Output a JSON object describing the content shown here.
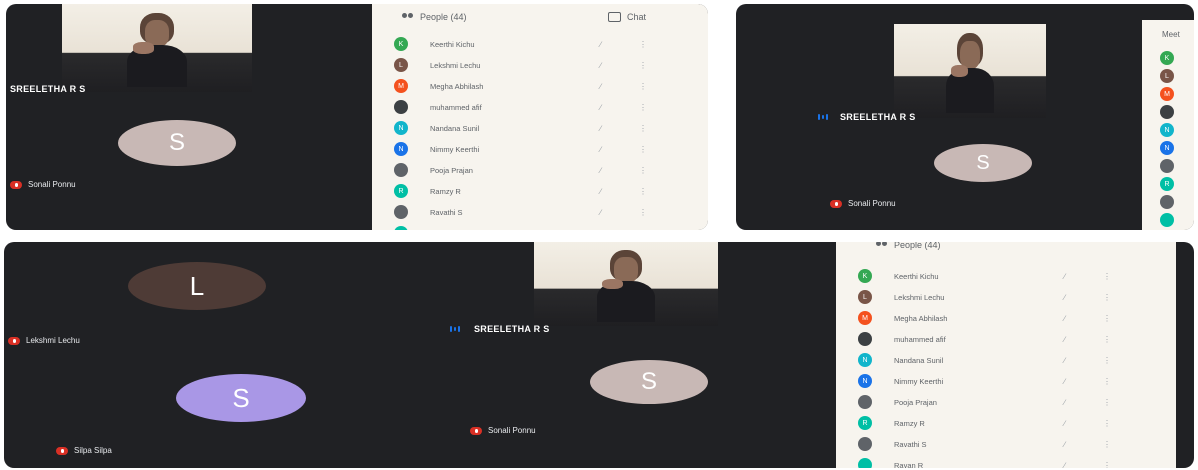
{
  "people_header": "People (44)",
  "people_header_bottom": "People (44)",
  "chat_label": "Chat",
  "meeting_title_partial": "Meet",
  "speaker_name": "SREELETHA R S",
  "tiles": {
    "sonali": {
      "letter": "S",
      "name": "Sonali Ponnu",
      "color": "#c8b8b5"
    },
    "lekshmi": {
      "letter": "L",
      "name": "Lekshmi Lechu",
      "color": "#4e3b36"
    },
    "silpa": {
      "letter": "S",
      "name": "Silpa Silpa",
      "color": "#a997e6"
    }
  },
  "participants": [
    {
      "initial": "K",
      "name": "Keerthi Kichu",
      "color": "#34a853"
    },
    {
      "initial": "L",
      "name": "Lekshmi Lechu",
      "color": "#795548"
    },
    {
      "initial": "M",
      "name": "Megha Abhilash",
      "color": "#f4511e"
    },
    {
      "initial": "",
      "name": "muhammed afif",
      "color": "#3c4043"
    },
    {
      "initial": "N",
      "name": "Nandana Sunil",
      "color": "#12b5cb"
    },
    {
      "initial": "N",
      "name": "Nimmy Keerthi",
      "color": "#1a73e8"
    },
    {
      "initial": "",
      "name": "Pooja Prajan",
      "color": "#5f6368"
    },
    {
      "initial": "R",
      "name": "Ramzy R",
      "color": "#00bfa5"
    },
    {
      "initial": "",
      "name": "Ravathi S",
      "color": "#5f6368"
    },
    {
      "initial": "",
      "name": "Rayan R",
      "color": "#00bfa5"
    }
  ],
  "icons": {
    "mic_off": "mic-off-icon",
    "more": "more-vert-icon",
    "people": "people-icon",
    "chat": "chat-icon"
  }
}
